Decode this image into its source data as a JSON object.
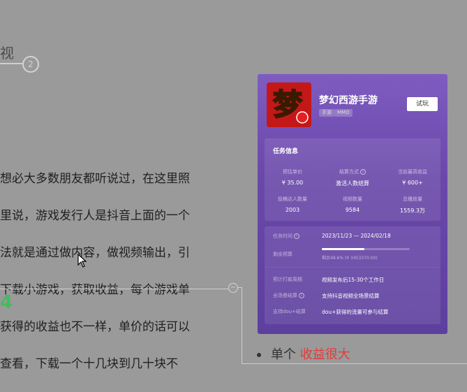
{
  "slide": {
    "heading_fragment": "视",
    "step_number": "2",
    "paragraph_lines": [
      "想必大多数朋友都听说过，在这里照",
      "里说，游戏发行人是抖音上面的一个",
      "法就是通过做内容，做视频输出，引",
      "下载小游戏，获取收益，每个游戏单",
      "获得的收益也不一样，单价的话可以",
      "查看，下载一个十几块到几十块不"
    ],
    "green_fragment": "4",
    "bullet_text": "单个 ",
    "bullet_highlight": "收益很大"
  },
  "card": {
    "game_title": "梦幻西游手游",
    "icon_glyph": "梦",
    "tags": [
      "手游",
      "MMO"
    ],
    "try_label": "试玩",
    "section_title": "任务信息",
    "stats_row1": [
      {
        "label": "预估单价",
        "value": "¥ 35.00"
      },
      {
        "label": "结算方式",
        "value": "激活人数结算"
      },
      {
        "label": "当前最高收益",
        "value": "¥ 600+"
      }
    ],
    "stats_row2": [
      {
        "label": "投稿达人数量",
        "value": "2003"
      },
      {
        "label": "视频数量",
        "value": "9584"
      },
      {
        "label": "总播放量",
        "value": "1559.3万"
      }
    ],
    "detail_rows": {
      "time_label": "任务时间",
      "time_value": "2023/11/23 — 2024/02/18",
      "budget_label": "剩余预算",
      "budget_sub": "剩余48.6% (¥ 3453370.00)",
      "budget_progress": 0.486,
      "settle_label": "预计打款周期",
      "settle_value": "视频发布后15-30个工作日",
      "scene_label": "全场景结算",
      "scene_value": "支持抖音视频全场景结算",
      "dou_label": "支持dou+结算",
      "dou_value": "dou+获得的流量可参与结算"
    }
  },
  "colors": {
    "background": "#9a9a9a",
    "card_purple": "#6a48aa",
    "highlight_red": "#e23b3b",
    "highlight_green": "#3fbf5a"
  }
}
